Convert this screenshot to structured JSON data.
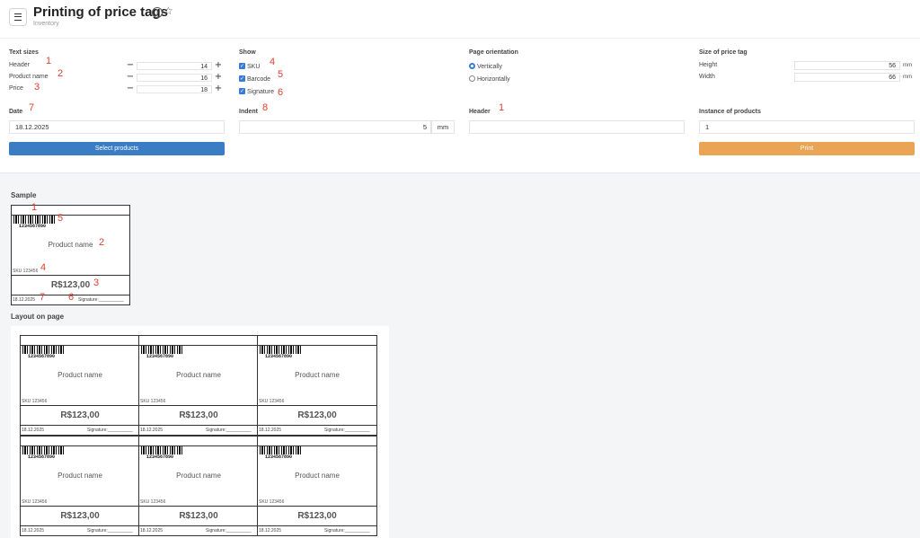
{
  "header": {
    "title": "Printing of price tags",
    "subtitle": "Inventory"
  },
  "icons": {
    "menu": "hamburger-icon",
    "info": "info-icon",
    "favorite": "star-icon"
  },
  "text_sizes": {
    "label": "Text sizes",
    "items": [
      {
        "label": "Header",
        "value": "14",
        "marker": "1"
      },
      {
        "label": "Product name",
        "value": "16",
        "marker": "2"
      },
      {
        "label": "Price",
        "value": "18",
        "marker": "3"
      }
    ],
    "minus": "−",
    "plus": "+"
  },
  "show": {
    "label": "Show",
    "items": [
      {
        "label": "SKU",
        "checked": true,
        "marker": "4"
      },
      {
        "label": "Barcode",
        "checked": true,
        "marker": "5"
      },
      {
        "label": "Signature",
        "checked": true,
        "marker": "6"
      }
    ]
  },
  "orientation": {
    "label": "Page orientation",
    "options": [
      {
        "label": "Vertically",
        "selected": true
      },
      {
        "label": "Horizontally",
        "selected": false
      }
    ]
  },
  "tag_size": {
    "label": "Size of price tag",
    "height_label": "Height",
    "height_value": "56",
    "width_label": "Width",
    "width_value": "66",
    "unit": "mm"
  },
  "date": {
    "label": "Date",
    "value": "18.12.2025",
    "marker": "7"
  },
  "indent": {
    "label": "Indent",
    "value": "5",
    "unit": "mm",
    "marker": "8"
  },
  "header_field": {
    "label": "Header",
    "value": "",
    "marker": "1"
  },
  "instance": {
    "label": "Instance of products",
    "value": "1"
  },
  "buttons": {
    "select": "Select products",
    "print": "Print"
  },
  "sample": {
    "label": "Sample",
    "barcode": "1234567890",
    "product_name": "Product name",
    "sku": "SKU 123456",
    "price": "R$123,00",
    "date": "18.12.2025",
    "signature": "Signature:__________",
    "markers": {
      "header": "1",
      "barcode": "5",
      "name": "2",
      "sku": "4",
      "price": "3",
      "date": "7",
      "signature": "6"
    }
  },
  "layout_label": "Layout on page",
  "colors": {
    "accent_blue": "#3b7dc4",
    "print_orange": "#e9a555",
    "marker_red": "#e0402f"
  }
}
